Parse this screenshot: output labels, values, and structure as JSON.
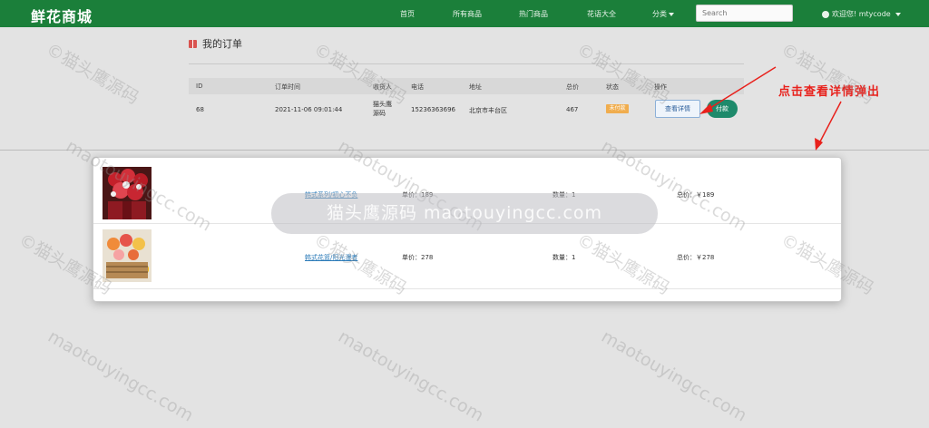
{
  "navbar": {
    "brand": "鲜花商城",
    "links": [
      "首页",
      "所有商品",
      "热门商品",
      "花语大全",
      "分类"
    ],
    "search_placeholder": "Search",
    "user_text": "欢迎您! mtycode"
  },
  "page": {
    "title": "我的订单",
    "columns": [
      "ID",
      "订单时间",
      "收货人",
      "电话",
      "地址",
      "总价",
      "状态",
      "操作"
    ],
    "order": {
      "id": "68",
      "time": "2021-11-06 09:01:44",
      "receiver_line1": "猫头鹰",
      "receiver_line2": "源码",
      "phone": "15236363696",
      "address": "北京市丰台区",
      "total": "467",
      "status": "未付款",
      "detail_label": "查看详情",
      "pay_label": "付款"
    }
  },
  "modal": {
    "items": [
      {
        "name": "韩式系列/初心不负",
        "price": "单价：189",
        "qty": "数量：1",
        "total": "总价：￥189"
      },
      {
        "name": "韩式花篮/阳光漫者",
        "price": "单价：278",
        "qty": "数量：1",
        "total": "总价：￥278"
      }
    ]
  },
  "annotation": {
    "text": "点击查看详情弹出",
    "color": "#e8211c"
  },
  "watermark": {
    "mark": "©猫头鹰源码",
    "url": "maotouyingcc.com",
    "banner": "猫头鹰源码 maotouyingcc.com"
  },
  "colors": {
    "navbar": "#1b7f3a",
    "pay_button": "#1e8a6b",
    "status_badge": "#f0ad4e"
  }
}
